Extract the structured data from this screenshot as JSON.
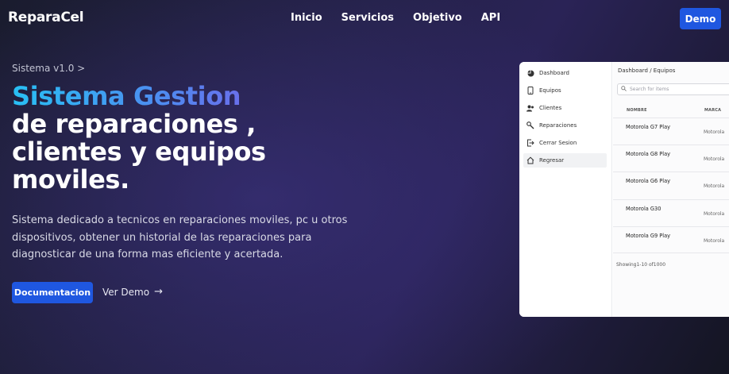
{
  "nav": {
    "brand": "ReparaCel",
    "links": [
      "Inicio",
      "Servicios",
      "Objetivo",
      "API"
    ],
    "demo_button": "Demo"
  },
  "hero": {
    "version": "Sistema v1.0 >",
    "headline_gradient": "Sistema Gestion",
    "headline_lines": [
      "de reparaciones ,",
      "clientes y equipos",
      "moviles."
    ],
    "description": "Sistema dedicado a tecnicos en reparaciones moviles, pc u otros dispositivos, obtener un historial de las reparaciones para diagnosticar de una forma mas eficiente y acertada.",
    "cta_primary": "Documentacion",
    "cta_secondary": "Ver Demo",
    "cta_secondary_icon": "arrow-right-icon"
  },
  "mockup": {
    "sidebar": [
      {
        "label": "Dashboard",
        "icon": "pie-chart-icon",
        "active": false
      },
      {
        "label": "Equipos",
        "icon": "phone-icon",
        "active": false
      },
      {
        "label": "Clientes",
        "icon": "users-icon",
        "active": false
      },
      {
        "label": "Reparaciones",
        "icon": "wrench-icon",
        "active": false
      },
      {
        "label": "Cerrar Sesion",
        "icon": "logout-icon",
        "active": false
      },
      {
        "label": "Regresar",
        "icon": "home-icon",
        "active": true
      }
    ],
    "breadcrumb": "Dashboard  /  Equipos",
    "search_placeholder": "Search for items",
    "columns": [
      "NOMBRE",
      "MARCA"
    ],
    "rows": [
      {
        "name": "Motorola G7 Play",
        "brand": "Motorola"
      },
      {
        "name": "Motorola G8 Play",
        "brand": "Motorola"
      },
      {
        "name": "Motorola G6 Play",
        "brand": "Motorola"
      },
      {
        "name": "Motorola G30",
        "brand": "Motorola"
      },
      {
        "name": "Motorola G9 Play",
        "brand": "Motorola"
      }
    ],
    "showing": "Showing1-10 of1000"
  },
  "colors": {
    "accent": "#1f57e0",
    "gradient_start": "#28c0f4",
    "gradient_end": "#8c4be6"
  }
}
